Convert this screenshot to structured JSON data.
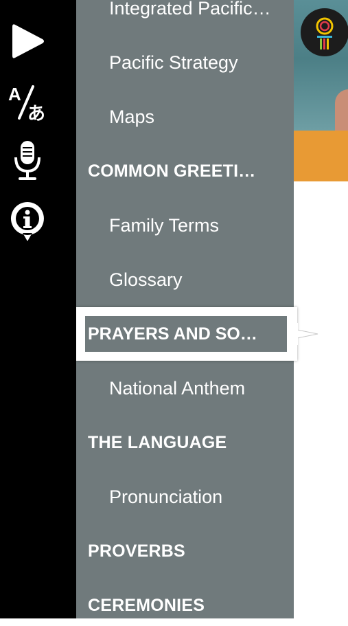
{
  "toolbar": {
    "items": [
      {
        "icon": "play-icon"
      },
      {
        "icon": "translate-icon"
      },
      {
        "icon": "microphone-icon"
      },
      {
        "icon": "info-icon"
      }
    ]
  },
  "menu": {
    "items": [
      {
        "label": "Integrated Pacific…",
        "type": "sub"
      },
      {
        "label": "Pacific Strategy",
        "type": "sub"
      },
      {
        "label": "Maps",
        "type": "sub"
      },
      {
        "label": "COMMON GREETI…",
        "type": "head"
      },
      {
        "label": "Family Terms",
        "type": "sub"
      },
      {
        "label": "Glossary",
        "type": "sub"
      },
      {
        "label": "PRAYERS AND SO…",
        "type": "head",
        "selected": true
      },
      {
        "label": "National Anthem",
        "type": "sub"
      },
      {
        "label": "THE LANGUAGE",
        "type": "head"
      },
      {
        "label": "Pronunciation",
        "type": "sub"
      },
      {
        "label": "PROVERBS",
        "type": "head"
      },
      {
        "label": "CEREMONIES",
        "type": "head"
      }
    ]
  },
  "colors": {
    "toolbar_bg": "#000000",
    "menu_bg": "#707a7c",
    "banner": "#e89a34"
  }
}
